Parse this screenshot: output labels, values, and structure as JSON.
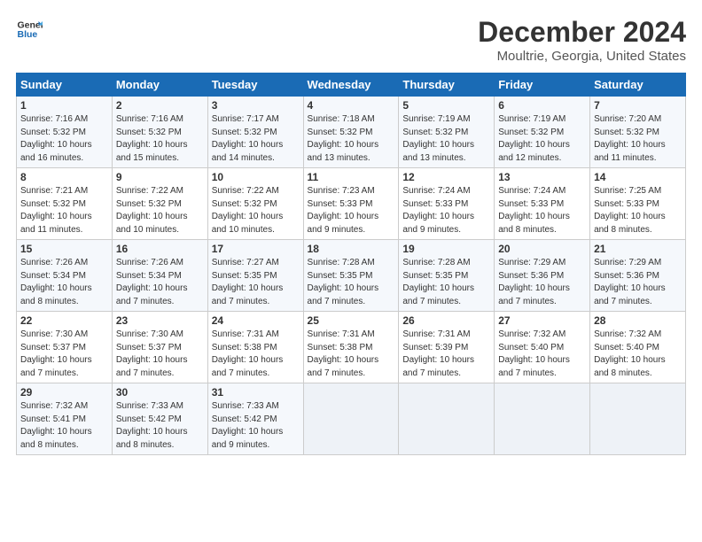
{
  "logo": {
    "line1": "General",
    "line2": "Blue"
  },
  "title": "December 2024",
  "location": "Moultrie, Georgia, United States",
  "days_of_week": [
    "Sunday",
    "Monday",
    "Tuesday",
    "Wednesday",
    "Thursday",
    "Friday",
    "Saturday"
  ],
  "weeks": [
    [
      {
        "num": "1",
        "sunrise": "Sunrise: 7:16 AM",
        "sunset": "Sunset: 5:32 PM",
        "daylight": "Daylight: 10 hours and 16 minutes."
      },
      {
        "num": "2",
        "sunrise": "Sunrise: 7:16 AM",
        "sunset": "Sunset: 5:32 PM",
        "daylight": "Daylight: 10 hours and 15 minutes."
      },
      {
        "num": "3",
        "sunrise": "Sunrise: 7:17 AM",
        "sunset": "Sunset: 5:32 PM",
        "daylight": "Daylight: 10 hours and 14 minutes."
      },
      {
        "num": "4",
        "sunrise": "Sunrise: 7:18 AM",
        "sunset": "Sunset: 5:32 PM",
        "daylight": "Daylight: 10 hours and 13 minutes."
      },
      {
        "num": "5",
        "sunrise": "Sunrise: 7:19 AM",
        "sunset": "Sunset: 5:32 PM",
        "daylight": "Daylight: 10 hours and 13 minutes."
      },
      {
        "num": "6",
        "sunrise": "Sunrise: 7:19 AM",
        "sunset": "Sunset: 5:32 PM",
        "daylight": "Daylight: 10 hours and 12 minutes."
      },
      {
        "num": "7",
        "sunrise": "Sunrise: 7:20 AM",
        "sunset": "Sunset: 5:32 PM",
        "daylight": "Daylight: 10 hours and 11 minutes."
      }
    ],
    [
      {
        "num": "8",
        "sunrise": "Sunrise: 7:21 AM",
        "sunset": "Sunset: 5:32 PM",
        "daylight": "Daylight: 10 hours and 11 minutes."
      },
      {
        "num": "9",
        "sunrise": "Sunrise: 7:22 AM",
        "sunset": "Sunset: 5:32 PM",
        "daylight": "Daylight: 10 hours and 10 minutes."
      },
      {
        "num": "10",
        "sunrise": "Sunrise: 7:22 AM",
        "sunset": "Sunset: 5:32 PM",
        "daylight": "Daylight: 10 hours and 10 minutes."
      },
      {
        "num": "11",
        "sunrise": "Sunrise: 7:23 AM",
        "sunset": "Sunset: 5:33 PM",
        "daylight": "Daylight: 10 hours and 9 minutes."
      },
      {
        "num": "12",
        "sunrise": "Sunrise: 7:24 AM",
        "sunset": "Sunset: 5:33 PM",
        "daylight": "Daylight: 10 hours and 9 minutes."
      },
      {
        "num": "13",
        "sunrise": "Sunrise: 7:24 AM",
        "sunset": "Sunset: 5:33 PM",
        "daylight": "Daylight: 10 hours and 8 minutes."
      },
      {
        "num": "14",
        "sunrise": "Sunrise: 7:25 AM",
        "sunset": "Sunset: 5:33 PM",
        "daylight": "Daylight: 10 hours and 8 minutes."
      }
    ],
    [
      {
        "num": "15",
        "sunrise": "Sunrise: 7:26 AM",
        "sunset": "Sunset: 5:34 PM",
        "daylight": "Daylight: 10 hours and 8 minutes."
      },
      {
        "num": "16",
        "sunrise": "Sunrise: 7:26 AM",
        "sunset": "Sunset: 5:34 PM",
        "daylight": "Daylight: 10 hours and 7 minutes."
      },
      {
        "num": "17",
        "sunrise": "Sunrise: 7:27 AM",
        "sunset": "Sunset: 5:35 PM",
        "daylight": "Daylight: 10 hours and 7 minutes."
      },
      {
        "num": "18",
        "sunrise": "Sunrise: 7:28 AM",
        "sunset": "Sunset: 5:35 PM",
        "daylight": "Daylight: 10 hours and 7 minutes."
      },
      {
        "num": "19",
        "sunrise": "Sunrise: 7:28 AM",
        "sunset": "Sunset: 5:35 PM",
        "daylight": "Daylight: 10 hours and 7 minutes."
      },
      {
        "num": "20",
        "sunrise": "Sunrise: 7:29 AM",
        "sunset": "Sunset: 5:36 PM",
        "daylight": "Daylight: 10 hours and 7 minutes."
      },
      {
        "num": "21",
        "sunrise": "Sunrise: 7:29 AM",
        "sunset": "Sunset: 5:36 PM",
        "daylight": "Daylight: 10 hours and 7 minutes."
      }
    ],
    [
      {
        "num": "22",
        "sunrise": "Sunrise: 7:30 AM",
        "sunset": "Sunset: 5:37 PM",
        "daylight": "Daylight: 10 hours and 7 minutes."
      },
      {
        "num": "23",
        "sunrise": "Sunrise: 7:30 AM",
        "sunset": "Sunset: 5:37 PM",
        "daylight": "Daylight: 10 hours and 7 minutes."
      },
      {
        "num": "24",
        "sunrise": "Sunrise: 7:31 AM",
        "sunset": "Sunset: 5:38 PM",
        "daylight": "Daylight: 10 hours and 7 minutes."
      },
      {
        "num": "25",
        "sunrise": "Sunrise: 7:31 AM",
        "sunset": "Sunset: 5:38 PM",
        "daylight": "Daylight: 10 hours and 7 minutes."
      },
      {
        "num": "26",
        "sunrise": "Sunrise: 7:31 AM",
        "sunset": "Sunset: 5:39 PM",
        "daylight": "Daylight: 10 hours and 7 minutes."
      },
      {
        "num": "27",
        "sunrise": "Sunrise: 7:32 AM",
        "sunset": "Sunset: 5:40 PM",
        "daylight": "Daylight: 10 hours and 7 minutes."
      },
      {
        "num": "28",
        "sunrise": "Sunrise: 7:32 AM",
        "sunset": "Sunset: 5:40 PM",
        "daylight": "Daylight: 10 hours and 8 minutes."
      }
    ],
    [
      {
        "num": "29",
        "sunrise": "Sunrise: 7:32 AM",
        "sunset": "Sunset: 5:41 PM",
        "daylight": "Daylight: 10 hours and 8 minutes."
      },
      {
        "num": "30",
        "sunrise": "Sunrise: 7:33 AM",
        "sunset": "Sunset: 5:42 PM",
        "daylight": "Daylight: 10 hours and 8 minutes."
      },
      {
        "num": "31",
        "sunrise": "Sunrise: 7:33 AM",
        "sunset": "Sunset: 5:42 PM",
        "daylight": "Daylight: 10 hours and 9 minutes."
      },
      null,
      null,
      null,
      null
    ]
  ]
}
